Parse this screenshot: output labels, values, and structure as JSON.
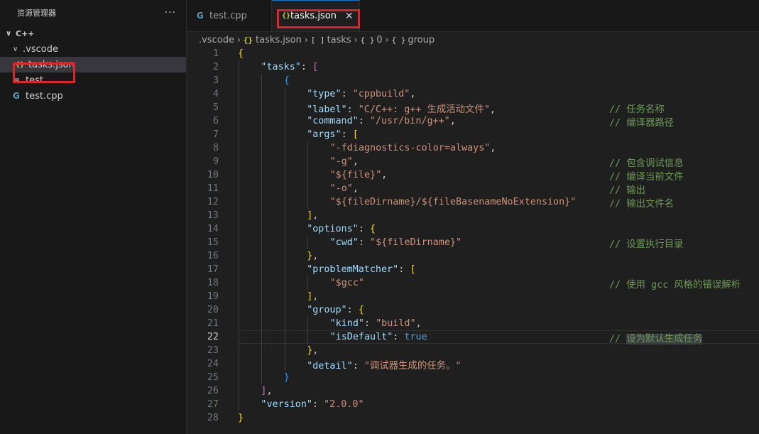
{
  "sidebar": {
    "title": "资源管理器",
    "more": "···",
    "root": "C++",
    "vscode_folder": ".vscode",
    "items": [
      {
        "label": "tasks.json",
        "icon": "json-icon"
      },
      {
        "label": "test",
        "icon": "text-file-icon"
      },
      {
        "label": "test.cpp",
        "icon": "cpp-file-icon"
      }
    ]
  },
  "tabs": [
    {
      "label": "test.cpp",
      "icon": "cpp-file-icon",
      "active": false
    },
    {
      "label": "tasks.json",
      "icon": "json-icon",
      "active": true
    }
  ],
  "breadcrumb": [
    ".vscode",
    "tasks.json",
    "tasks",
    "0",
    "group"
  ],
  "highlight_color": "#e0242b",
  "current_line": 22,
  "code_lines": [
    {
      "n": "1",
      "indent": 0,
      "tokens": [
        [
          "{",
          "b1"
        ]
      ],
      "comment": ""
    },
    {
      "n": "2",
      "indent": 1,
      "tokens": [
        [
          "\"tasks\"",
          "key"
        ],
        [
          ": ",
          "p"
        ],
        [
          "[",
          "b2"
        ]
      ],
      "comment": ""
    },
    {
      "n": "3",
      "indent": 2,
      "tokens": [
        [
          "{",
          "b3"
        ]
      ],
      "comment": ""
    },
    {
      "n": "4",
      "indent": 3,
      "tokens": [
        [
          "\"type\"",
          "key"
        ],
        [
          ": ",
          "p"
        ],
        [
          "\"cppbuild\"",
          "str"
        ],
        [
          ",",
          "p"
        ]
      ],
      "comment": ""
    },
    {
      "n": "5",
      "indent": 3,
      "tokens": [
        [
          "\"label\"",
          "key"
        ],
        [
          ": ",
          "p"
        ],
        [
          "\"C/C++: g++ 生成活动文件\"",
          "str"
        ],
        [
          ",",
          "p"
        ]
      ],
      "comment": "// 任务名称"
    },
    {
      "n": "6",
      "indent": 3,
      "tokens": [
        [
          "\"command\"",
          "key"
        ],
        [
          ": ",
          "p"
        ],
        [
          "\"/usr/bin/g++\"",
          "str"
        ],
        [
          ",",
          "p"
        ]
      ],
      "comment": "// 编译器路径"
    },
    {
      "n": "7",
      "indent": 3,
      "tokens": [
        [
          "\"args\"",
          "key"
        ],
        [
          ": ",
          "p"
        ],
        [
          "[",
          "b1"
        ]
      ],
      "comment": ""
    },
    {
      "n": "8",
      "indent": 4,
      "tokens": [
        [
          "\"-fdiagnostics-color=always\"",
          "str"
        ],
        [
          ",",
          "p"
        ]
      ],
      "comment": ""
    },
    {
      "n": "9",
      "indent": 4,
      "tokens": [
        [
          "\"-g\"",
          "str"
        ],
        [
          ",",
          "p"
        ]
      ],
      "comment": "// 包含调试信息"
    },
    {
      "n": "10",
      "indent": 4,
      "tokens": [
        [
          "\"${file}\"",
          "str"
        ],
        [
          ",",
          "p"
        ]
      ],
      "comment": "// 编译当前文件"
    },
    {
      "n": "11",
      "indent": 4,
      "tokens": [
        [
          "\"-o\"",
          "str"
        ],
        [
          ",",
          "p"
        ]
      ],
      "comment": "// 输出"
    },
    {
      "n": "12",
      "indent": 4,
      "tokens": [
        [
          "\"${fileDirname}/${fileBasenameNoExtension}\"",
          "str"
        ]
      ],
      "comment": "// 输出文件名"
    },
    {
      "n": "13",
      "indent": 3,
      "tokens": [
        [
          "]",
          "b1"
        ],
        [
          ",",
          "p"
        ]
      ],
      "comment": ""
    },
    {
      "n": "14",
      "indent": 3,
      "tokens": [
        [
          "\"options\"",
          "key"
        ],
        [
          ": ",
          "p"
        ],
        [
          "{",
          "b1"
        ]
      ],
      "comment": ""
    },
    {
      "n": "15",
      "indent": 4,
      "tokens": [
        [
          "\"cwd\"",
          "key"
        ],
        [
          ": ",
          "p"
        ],
        [
          "\"${fileDirname}\"",
          "str"
        ]
      ],
      "comment": "// 设置执行目录"
    },
    {
      "n": "16",
      "indent": 3,
      "tokens": [
        [
          "}",
          "b1"
        ],
        [
          ",",
          "p"
        ]
      ],
      "comment": ""
    },
    {
      "n": "17",
      "indent": 3,
      "tokens": [
        [
          "\"problemMatcher\"",
          "key"
        ],
        [
          ": ",
          "p"
        ],
        [
          "[",
          "b1"
        ]
      ],
      "comment": ""
    },
    {
      "n": "18",
      "indent": 4,
      "tokens": [
        [
          "\"$gcc\"",
          "str"
        ]
      ],
      "comment": "// 使用 gcc 风格的错误解析"
    },
    {
      "n": "19",
      "indent": 3,
      "tokens": [
        [
          "]",
          "b1"
        ],
        [
          ",",
          "p"
        ]
      ],
      "comment": ""
    },
    {
      "n": "20",
      "indent": 3,
      "tokens": [
        [
          "\"group\"",
          "key"
        ],
        [
          ": ",
          "p"
        ],
        [
          "{",
          "b1"
        ]
      ],
      "comment": ""
    },
    {
      "n": "21",
      "indent": 4,
      "tokens": [
        [
          "\"kind\"",
          "key"
        ],
        [
          ": ",
          "p"
        ],
        [
          "\"build\"",
          "str"
        ],
        [
          ",",
          "p"
        ]
      ],
      "comment": ""
    },
    {
      "n": "22",
      "indent": 4,
      "tokens": [
        [
          "\"isDefault\"",
          "key"
        ],
        [
          ": ",
          "p"
        ],
        [
          "true",
          "bool"
        ]
      ],
      "comment": "// 设为默认生成任务",
      "comment_selected": true
    },
    {
      "n": "23",
      "indent": 3,
      "tokens": [
        [
          "}",
          "b1"
        ],
        [
          ",",
          "p"
        ]
      ],
      "comment": ""
    },
    {
      "n": "24",
      "indent": 3,
      "tokens": [
        [
          "\"detail\"",
          "key"
        ],
        [
          ": ",
          "p"
        ],
        [
          "\"调试器生成的任务。\"",
          "str"
        ]
      ],
      "comment": ""
    },
    {
      "n": "25",
      "indent": 2,
      "tokens": [
        [
          "}",
          "b3"
        ]
      ],
      "comment": ""
    },
    {
      "n": "26",
      "indent": 1,
      "tokens": [
        [
          "]",
          "b2"
        ],
        [
          ",",
          "p"
        ]
      ],
      "comment": ""
    },
    {
      "n": "27",
      "indent": 1,
      "tokens": [
        [
          "\"version\"",
          "key"
        ],
        [
          ": ",
          "p"
        ],
        [
          "\"2.0.0\"",
          "str"
        ]
      ],
      "comment": ""
    },
    {
      "n": "28",
      "indent": 0,
      "tokens": [
        [
          "}",
          "b1"
        ]
      ],
      "comment": ""
    }
  ]
}
